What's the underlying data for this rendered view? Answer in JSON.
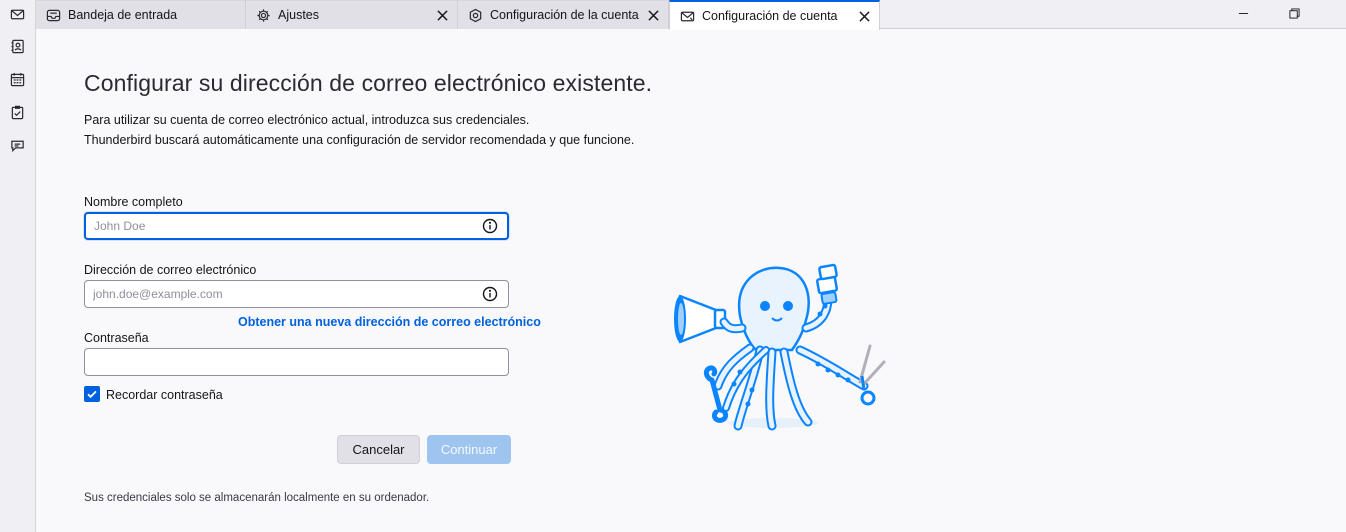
{
  "spaces": [
    "mail-icon",
    "address-book-icon",
    "calendar-icon",
    "tasks-icon",
    "chat-icon"
  ],
  "tabs": [
    {
      "label": "Bandeja de entrada",
      "icon": "inbox-icon"
    },
    {
      "label": "Ajustes",
      "icon": "gear-icon"
    },
    {
      "label": "Configuración de la cuenta",
      "icon": "account-settings-icon"
    },
    {
      "label": "Configuración de cuenta",
      "icon": "envelope-setup-icon"
    }
  ],
  "page": {
    "title": "Configurar su dirección de correo electrónico existente.",
    "intro_line1": "Para utilizar su cuenta de correo electrónico actual, introduzca sus credenciales.",
    "intro_line2": "Thunderbird buscará automáticamente una configuración de servidor recomendada y que funcione."
  },
  "form": {
    "name_label": "Nombre completo",
    "name_placeholder": "John Doe",
    "name_value": "",
    "email_label": "Dirección de correo electrónico",
    "email_placeholder": "john.doe@example.com",
    "email_value": "",
    "new_address_link": "Obtener una nueva dirección de correo electrónico",
    "password_label": "Contraseña",
    "password_value": "",
    "remember_label": "Recordar contraseña",
    "remember_checked": true,
    "cancel_label": "Cancelar",
    "continue_label": "Continuar"
  },
  "footer_note": "Sus credenciales solo se almacenarán localmente en su ordenador.",
  "colors": {
    "accent": "#0061e0",
    "continue_disabled": "#9ec5ef",
    "illustration_blue": "#0a84ff"
  }
}
